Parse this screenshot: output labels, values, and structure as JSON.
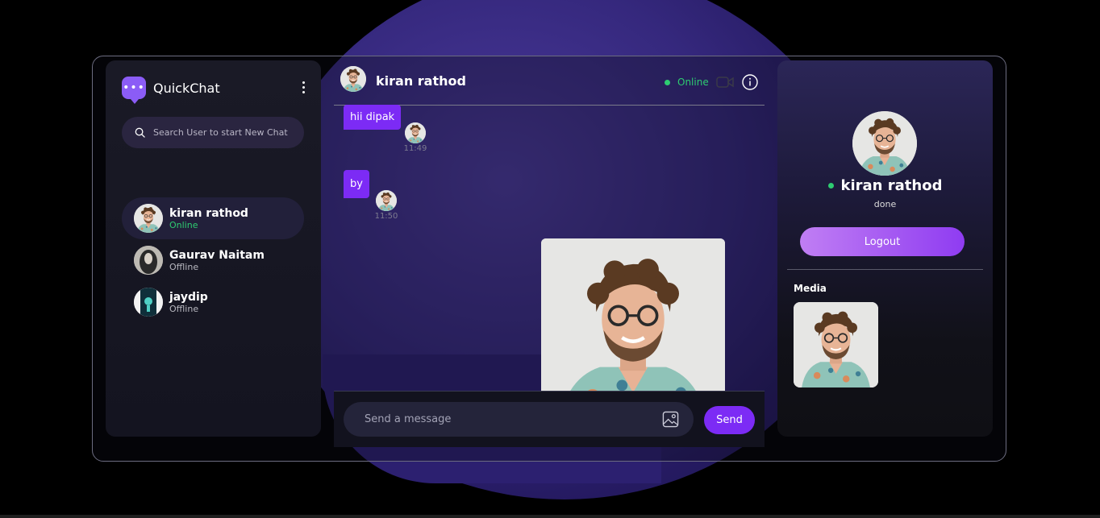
{
  "app": {
    "name": "QuickChat",
    "logo_glyph": "•••"
  },
  "search": {
    "placeholder": "Search User to start New Chat"
  },
  "users": [
    {
      "name": "kiran rathod",
      "status": "Online"
    },
    {
      "name": "Gaurav Naitam",
      "status": "Offline"
    },
    {
      "name": "jaydip",
      "status": "Offline"
    }
  ],
  "chat": {
    "name": "kiran rathod",
    "status": "Online",
    "messages": [
      {
        "text": "hii dipak",
        "time": "11:49"
      },
      {
        "text": "by",
        "time": "11:50"
      }
    ]
  },
  "composer": {
    "placeholder": "Send a message",
    "send_label": "Send"
  },
  "profile": {
    "name": "kiran rathod",
    "bio": "done",
    "logout_label": "Logout",
    "media_title": "Media"
  },
  "colors": {
    "accent": "#7c2bf5",
    "online": "#2ecc71",
    "background": "#000000"
  }
}
